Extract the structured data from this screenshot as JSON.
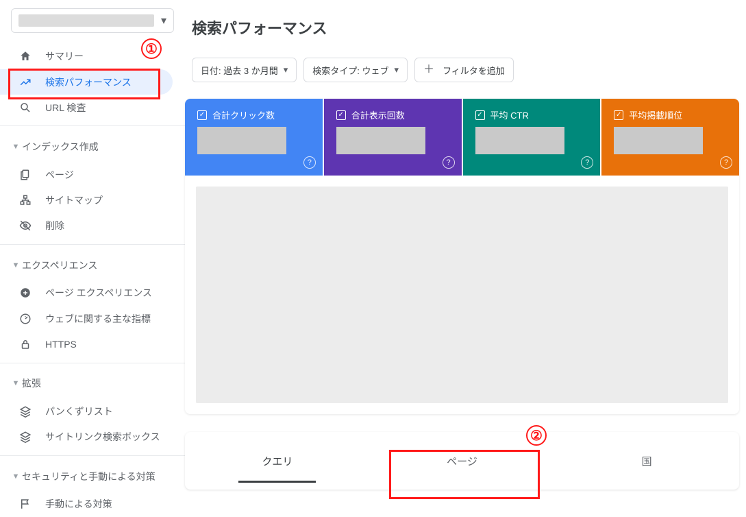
{
  "page_title": "検索パフォーマンス",
  "filters": {
    "date": {
      "label_prefix": "日付:",
      "value": "過去 3 か月間"
    },
    "search_type": {
      "label_prefix": "検索タイプ:",
      "value": "ウェブ"
    },
    "add_filter": "フィルタを追加"
  },
  "metrics": {
    "clicks": {
      "label": "合計クリック数",
      "checked": true
    },
    "impressions": {
      "label": "合計表示回数",
      "checked": true
    },
    "ctr": {
      "label": "平均 CTR",
      "checked": true
    },
    "position": {
      "label": "平均掲載順位",
      "checked": true
    }
  },
  "tabs": {
    "query": "クエリ",
    "page": "ページ",
    "country": "国"
  },
  "sidebar": {
    "items": {
      "summary": "サマリー",
      "performance": "検索パフォーマンス",
      "url_inspect": "URL 検査"
    },
    "group_index": {
      "title": "インデックス作成",
      "pages": "ページ",
      "sitemaps": "サイトマップ",
      "removals": "削除"
    },
    "group_experience": {
      "title": "エクスペリエンス",
      "page_exp": "ページ エクスペリエンス",
      "cwv": "ウェブに関する主な指標",
      "https": "HTTPS"
    },
    "group_enhance": {
      "title": "拡張",
      "breadcrumb": "パンくずリスト",
      "sitelinks": "サイトリンク検索ボックス"
    },
    "group_security": {
      "title": "セキュリティと手動による対策",
      "manual": "手動による対策"
    }
  },
  "annotations": {
    "one": "①",
    "two": "②"
  }
}
